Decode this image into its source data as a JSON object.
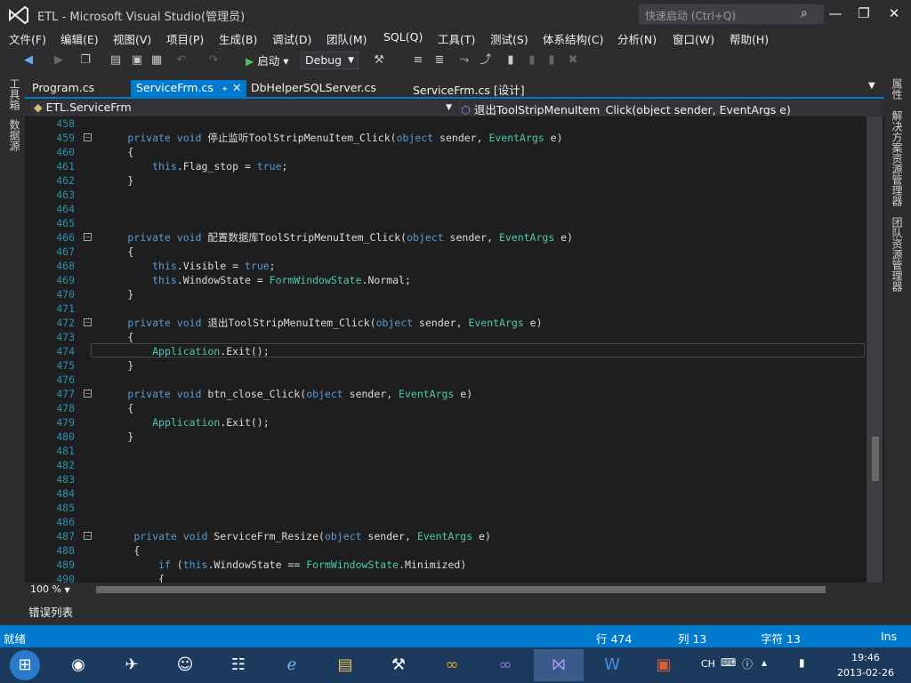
{
  "title_bar": {
    "title": "ETL - Microsoft Visual Studio(管理员)",
    "quick_launch_placeholder": "快速启动 (Ctrl+Q)"
  },
  "menu": [
    "文件(F)",
    "编辑(E)",
    "视图(V)",
    "项目(P)",
    "生成(B)",
    "调试(D)",
    "团队(M)",
    "SQL(Q)",
    "工具(T)",
    "测试(S)",
    "体系结构(C)",
    "分析(N)",
    "窗口(W)",
    "帮助(H)"
  ],
  "toolbar": {
    "start_label": "启动",
    "config_value": "Debug"
  },
  "left_panels": [
    "工具箱",
    "数据源"
  ],
  "right_panels": [
    "属性",
    "解决方案资源管理器",
    "团队资源管理器"
  ],
  "tabs": [
    {
      "label": "Program.cs",
      "active": false
    },
    {
      "label": "ServiceFrm.cs",
      "active": true
    },
    {
      "label": "DbHelperSQLServer.cs",
      "active": false
    },
    {
      "label": "ServiceFrm.cs [设计]",
      "active": false
    }
  ],
  "nav": {
    "class_name": "ETL.ServiceFrm",
    "member_name": "退出ToolStripMenuItem_Click(object sender, EventArgs e)"
  },
  "code_lines": [
    {
      "n": "458",
      "indent": "",
      "segs": []
    },
    {
      "n": "459",
      "fold": true,
      "segs": [
        [
          "kw",
          "private void "
        ],
        [
          "",
          "停止监听ToolStripMenuItem_Click("
        ],
        [
          "kw",
          "object"
        ],
        [
          "",
          " sender, "
        ],
        [
          "ty",
          "EventArgs"
        ],
        [
          "",
          " e)"
        ]
      ],
      "indent": "        "
    },
    {
      "n": "460",
      "indent": "        ",
      "segs": [
        [
          "",
          "{"
        ]
      ]
    },
    {
      "n": "461",
      "indent": "            ",
      "segs": [
        [
          "kw",
          "this"
        ],
        [
          "",
          ".Flag_stop = "
        ],
        [
          "kw",
          "true"
        ],
        [
          "",
          ";"
        ]
      ]
    },
    {
      "n": "462",
      "indent": "        ",
      "segs": [
        [
          "",
          "}"
        ]
      ]
    },
    {
      "n": "463",
      "indent": "",
      "segs": []
    },
    {
      "n": "464",
      "indent": "",
      "segs": []
    },
    {
      "n": "465",
      "indent": "",
      "segs": []
    },
    {
      "n": "466",
      "fold": true,
      "indent": "        ",
      "segs": [
        [
          "kw",
          "private void "
        ],
        [
          "",
          "配置数据库ToolStripMenuItem_Click("
        ],
        [
          "kw",
          "object"
        ],
        [
          "",
          " sender, "
        ],
        [
          "ty",
          "EventArgs"
        ],
        [
          "",
          " e)"
        ]
      ]
    },
    {
      "n": "467",
      "indent": "        ",
      "segs": [
        [
          "",
          "{"
        ]
      ]
    },
    {
      "n": "468",
      "indent": "            ",
      "segs": [
        [
          "kw",
          "this"
        ],
        [
          "",
          ".Visible = "
        ],
        [
          "kw",
          "true"
        ],
        [
          "",
          ";"
        ]
      ]
    },
    {
      "n": "469",
      "indent": "            ",
      "segs": [
        [
          "kw",
          "this"
        ],
        [
          "",
          ".WindowState = "
        ],
        [
          "ty",
          "FormWindowState"
        ],
        [
          "",
          ".Normal;"
        ]
      ]
    },
    {
      "n": "470",
      "indent": "        ",
      "segs": [
        [
          "",
          "}"
        ]
      ]
    },
    {
      "n": "471",
      "indent": "",
      "segs": []
    },
    {
      "n": "472",
      "fold": true,
      "indent": "        ",
      "segs": [
        [
          "kw",
          "private void "
        ],
        [
          "",
          "退出ToolStripMenuItem_Click("
        ],
        [
          "kw",
          "object"
        ],
        [
          "",
          " sender, "
        ],
        [
          "ty",
          "EventArgs"
        ],
        [
          "",
          " e)"
        ]
      ]
    },
    {
      "n": "473",
      "indent": "        ",
      "segs": [
        [
          "",
          "{"
        ]
      ]
    },
    {
      "n": "474",
      "indent": "            ",
      "segs": [
        [
          "ty",
          "Application"
        ],
        [
          "",
          ".Exit();"
        ]
      ]
    },
    {
      "n": "475",
      "indent": "        ",
      "segs": [
        [
          "",
          "}"
        ]
      ]
    },
    {
      "n": "476",
      "indent": "",
      "segs": []
    },
    {
      "n": "477",
      "fold": true,
      "indent": "        ",
      "segs": [
        [
          "kw",
          "private void "
        ],
        [
          "",
          "btn_close_Click("
        ],
        [
          "kw",
          "object"
        ],
        [
          "",
          " sender, "
        ],
        [
          "ty",
          "EventArgs"
        ],
        [
          "",
          " e)"
        ]
      ]
    },
    {
      "n": "478",
      "indent": "        ",
      "segs": [
        [
          "",
          "{"
        ]
      ]
    },
    {
      "n": "479",
      "indent": "            ",
      "segs": [
        [
          "ty",
          "Application"
        ],
        [
          "",
          ".Exit();"
        ]
      ]
    },
    {
      "n": "480",
      "indent": "        ",
      "segs": [
        [
          "",
          "}"
        ]
      ]
    },
    {
      "n": "481",
      "indent": "",
      "segs": []
    },
    {
      "n": "482",
      "indent": "",
      "segs": []
    },
    {
      "n": "483",
      "indent": "",
      "segs": []
    },
    {
      "n": "484",
      "indent": "",
      "segs": []
    },
    {
      "n": "485",
      "indent": "",
      "segs": []
    },
    {
      "n": "486",
      "indent": "",
      "segs": []
    },
    {
      "n": "487",
      "fold": true,
      "indent": "         ",
      "segs": [
        [
          "kw",
          "private void "
        ],
        [
          "",
          "ServiceFrm_Resize("
        ],
        [
          "kw",
          "object"
        ],
        [
          "",
          " sender, "
        ],
        [
          "ty",
          "EventArgs"
        ],
        [
          "",
          " e)"
        ]
      ]
    },
    {
      "n": "488",
      "indent": "         ",
      "segs": [
        [
          "",
          "{"
        ]
      ]
    },
    {
      "n": "489",
      "indent": "             ",
      "segs": [
        [
          "kw",
          "if"
        ],
        [
          "",
          " ("
        ],
        [
          "kw",
          "this"
        ],
        [
          "",
          ".WindowState == "
        ],
        [
          "ty",
          "FormWindowState"
        ],
        [
          "",
          ".Minimized)"
        ]
      ]
    },
    {
      "n": "490",
      "indent": "             ",
      "segs": [
        [
          "",
          "{"
        ]
      ]
    }
  ],
  "zoom": "100 %",
  "error_panel_tab": "错误列表",
  "status": {
    "ready": "就绪",
    "line": "行 474",
    "col": "列 13",
    "ch": "字符 13",
    "mode": "Ins"
  },
  "clock": {
    "time": "19:46",
    "date": "2013-02-26"
  },
  "tray": {
    "lang": "CH"
  }
}
